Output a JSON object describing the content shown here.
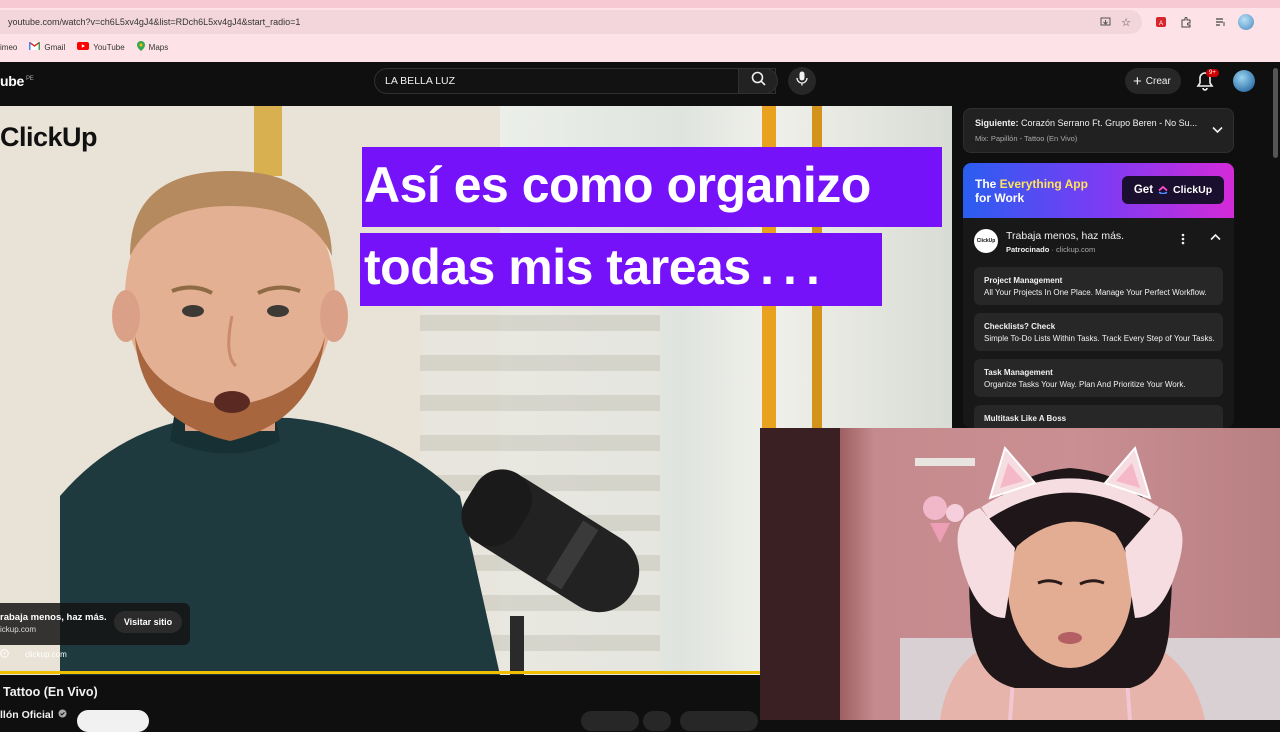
{
  "browser": {
    "url": "youtube.com/watch?v=ch6L5xv4gJ4&list=RDch6L5xv4gJ4&start_radio=1",
    "bookmarks": [
      {
        "label": "imeo",
        "icon": "vimeo-icon"
      },
      {
        "label": "Gmail",
        "icon": "gmail-icon"
      },
      {
        "label": "YouTube",
        "icon": "youtube-icon"
      },
      {
        "label": "Maps",
        "icon": "maps-icon"
      }
    ]
  },
  "youtube": {
    "logo_text": "ube",
    "region": "PE",
    "search_value": "LA BELLA LUZ",
    "create_label": "Crear",
    "notif_badge": "9+"
  },
  "video": {
    "brand": "ClickUp",
    "headline_1": "Así es como organizo",
    "headline_2": "todas mis tareas . . .",
    "ad_title": "rabaja menos, haz más.",
    "ad_domain": "ickup.com",
    "visit_label": "Visitar sitio",
    "bottom_domain": "clickup.com",
    "title": "Tattoo (En Vivo)",
    "channel": "llón Oficial"
  },
  "sidebar": {
    "next_label": "Siguiente:",
    "next_title": "Corazón Serrano Ft. Grupo Beren - No Su...",
    "mix_label": "Mix: Papillón - Tattoo (En Vivo)",
    "banner_text_1": "The ",
    "banner_highlight": "Everything App",
    "banner_text_2": "for Work",
    "banner_get": "Get",
    "banner_brand": "ClickUp",
    "sponsor_logo": "ClickUp",
    "sponsor_title": "Trabaja menos, haz más.",
    "sponsor_tag": "Patrocinado",
    "sponsor_domain": " · clickup.com",
    "sitelinks": [
      {
        "title": "Project Management",
        "desc": "All Your Projects In One Place. Manage Your Perfect Workflow."
      },
      {
        "title": "Checklists? Check",
        "desc": "Simple To-Do Lists Within Tasks. Track Every Step of Your Tasks."
      },
      {
        "title": "Task Management",
        "desc": "Organize Tasks Your Way. Plan And Prioritize Your Work."
      },
      {
        "title": "Multitask Like A Boss",
        "desc": ""
      }
    ]
  }
}
